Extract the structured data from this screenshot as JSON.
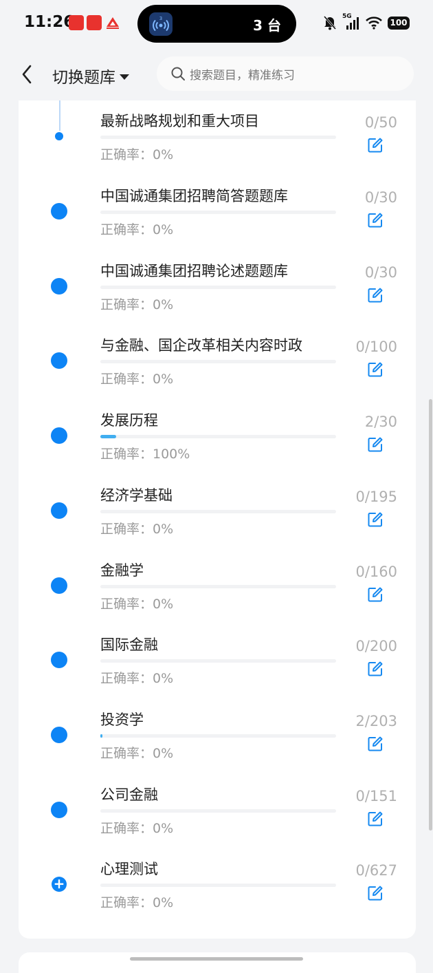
{
  "status": {
    "time": "11:26",
    "island_count": "3 台",
    "network": "5G",
    "battery": "100",
    "notif_icons": [
      "小红书",
      "小红书",
      "app-logo"
    ]
  },
  "nav": {
    "title": "切换题库",
    "search_placeholder": "搜索题目，精准练习"
  },
  "accuracy_prefix": "正确率：",
  "items": [
    {
      "title": "最新战略规划和重大项目",
      "accuracy": "正确率：0%",
      "count": "0/50",
      "progress": 0
    },
    {
      "title": "中国诚通集团招聘简答题题库",
      "accuracy": "正确率：0%",
      "count": "0/30",
      "progress": 0
    },
    {
      "title": "中国诚通集团招聘论述题题库",
      "accuracy": "正确率：0%",
      "count": "0/30",
      "progress": 0
    },
    {
      "title": "与金融、国企改革相关内容时政",
      "accuracy": "正确率：0%",
      "count": "0/100",
      "progress": 0
    },
    {
      "title": "发展历程",
      "accuracy": "正确率：100%",
      "count": "2/30",
      "progress": 0.0667
    },
    {
      "title": "经济学基础",
      "accuracy": "正确率：0%",
      "count": "0/195",
      "progress": 0
    },
    {
      "title": "金融学",
      "accuracy": "正确率：0%",
      "count": "0/160",
      "progress": 0
    },
    {
      "title": "国际金融",
      "accuracy": "正确率：0%",
      "count": "0/200",
      "progress": 0
    },
    {
      "title": "投资学",
      "accuracy": "正确率：0%",
      "count": "2/203",
      "progress": 0.0099
    },
    {
      "title": "公司金融",
      "accuracy": "正确率：0%",
      "count": "0/151",
      "progress": 0
    },
    {
      "title": "心理测试",
      "accuracy": "正确率：0%",
      "count": "0/627",
      "progress": 0
    }
  ],
  "colors": {
    "accent": "#0d84f5",
    "progress": "#41aef0"
  }
}
